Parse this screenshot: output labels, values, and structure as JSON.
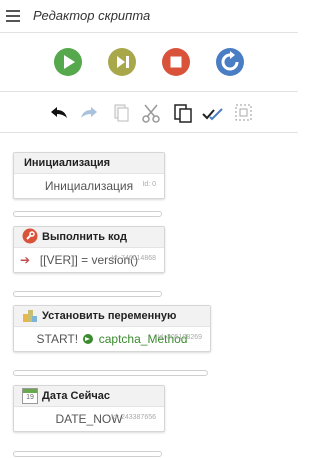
{
  "header": {
    "title": "Редактор скрипта"
  },
  "controls": [
    {
      "name": "play-button",
      "color": "#55a84b"
    },
    {
      "name": "step-button",
      "color": "#a8a84b"
    },
    {
      "name": "stop-button",
      "color": "#d9533a"
    },
    {
      "name": "restart-button",
      "color": "#4a7ec4"
    }
  ],
  "toolbar": [
    "undo-icon",
    "redo-icon",
    "copy-icon",
    "cut-icon",
    "paste-icon",
    "check-all-icon",
    "select-icon"
  ],
  "nodes": [
    {
      "title": "Инициализация",
      "body": "Инициализация",
      "id": "Id: 0"
    },
    {
      "title": "Выполнить код",
      "body": "[[VER]] = version()",
      "id": "Id: 746014868"
    },
    {
      "title": "Установить переменную",
      "body_prefix": "START!",
      "body_value": "captcha_Method",
      "id": "Id: 305108269"
    },
    {
      "title": "Дата Сейчас",
      "body": "DATE_NOW",
      "id": "Id: 243387656",
      "calendar_day": "19"
    }
  ]
}
